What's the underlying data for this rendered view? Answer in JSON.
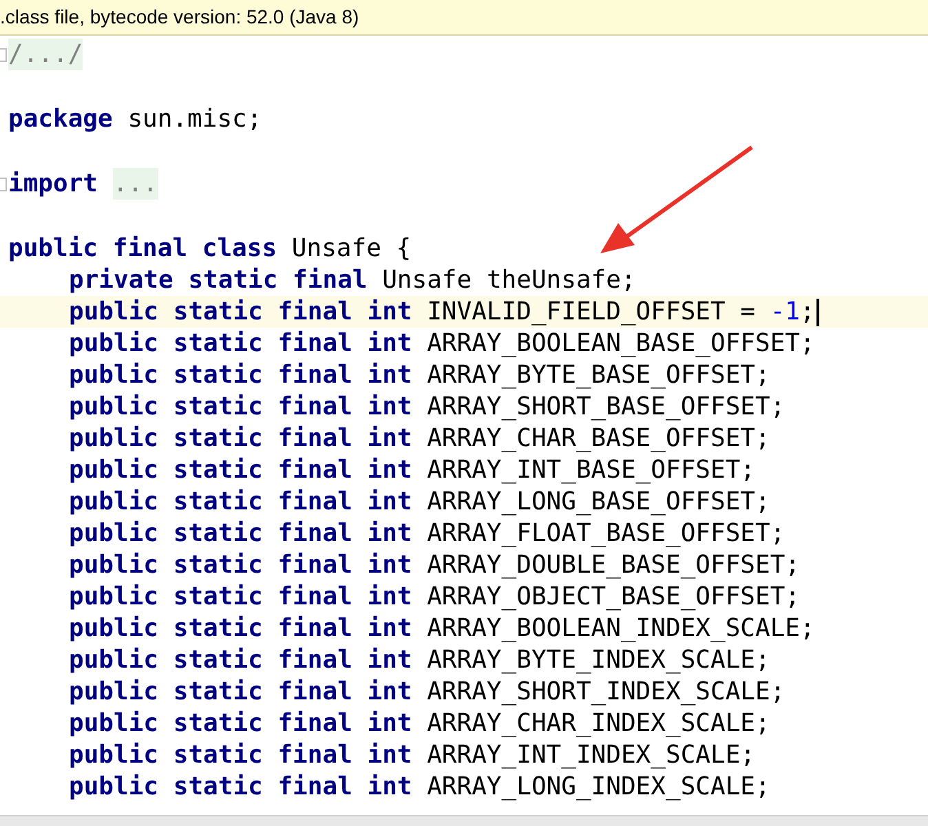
{
  "banner": {
    "text": ".class file, bytecode version: 52.0 (Java 8)"
  },
  "editor": {
    "lines": [
      {
        "kind": "code",
        "foldable": true,
        "current": false,
        "tokens": [
          {
            "kind": "folded",
            "text": "/.../"
          }
        ]
      },
      {
        "kind": "blank"
      },
      {
        "kind": "code",
        "foldable": false,
        "current": false,
        "tokens": [
          {
            "kind": "keyword",
            "text": "package"
          },
          {
            "kind": "text",
            "text": " sun.misc;"
          }
        ]
      },
      {
        "kind": "blank"
      },
      {
        "kind": "code",
        "foldable": true,
        "current": false,
        "tokens": [
          {
            "kind": "keyword",
            "text": "import"
          },
          {
            "kind": "folded",
            "text": "..."
          }
        ]
      },
      {
        "kind": "blank"
      },
      {
        "kind": "code",
        "foldable": false,
        "current": false,
        "tokens": [
          {
            "kind": "keyword",
            "text": "public final class"
          },
          {
            "kind": "text",
            "text": " Unsafe {"
          }
        ],
        "children": [
          {
            "kind": "code",
            "foldable": false,
            "current": false,
            "tokens": [
              {
                "kind": "keyword",
                "text": "private static final"
              },
              {
                "kind": "text",
                "text": " Unsafe theUnsafe;"
              }
            ]
          },
          {
            "kind": "code",
            "foldable": false,
            "current": true,
            "tokens": [
              {
                "kind": "keyword",
                "text": "public static final int"
              },
              {
                "kind": "text",
                "text": " INVALID_FIELD_OFFSET = "
              },
              {
                "kind": "number",
                "text": "-1"
              },
              {
                "kind": "text",
                "text": ";"
              }
            ]
          },
          {
            "kind": "code",
            "foldable": false,
            "current": false,
            "tokens": [
              {
                "kind": "keyword",
                "text": "public static final int"
              },
              {
                "kind": "text",
                "text": " ARRAY_BOOLEAN_BASE_OFFSET;"
              }
            ]
          },
          {
            "kind": "code",
            "foldable": false,
            "current": false,
            "tokens": [
              {
                "kind": "keyword",
                "text": "public static final int"
              },
              {
                "kind": "text",
                "text": " ARRAY_BYTE_BASE_OFFSET;"
              }
            ]
          },
          {
            "kind": "code",
            "foldable": false,
            "current": false,
            "tokens": [
              {
                "kind": "keyword",
                "text": "public static final int"
              },
              {
                "kind": "text",
                "text": " ARRAY_SHORT_BASE_OFFSET;"
              }
            ]
          },
          {
            "kind": "code",
            "foldable": false,
            "current": false,
            "tokens": [
              {
                "kind": "keyword",
                "text": "public static final int"
              },
              {
                "kind": "text",
                "text": " ARRAY_CHAR_BASE_OFFSET;"
              }
            ]
          },
          {
            "kind": "code",
            "foldable": false,
            "current": false,
            "tokens": [
              {
                "kind": "keyword",
                "text": "public static final int"
              },
              {
                "kind": "text",
                "text": " ARRAY_INT_BASE_OFFSET;"
              }
            ]
          },
          {
            "kind": "code",
            "foldable": false,
            "current": false,
            "tokens": [
              {
                "kind": "keyword",
                "text": "public static final int"
              },
              {
                "kind": "text",
                "text": " ARRAY_LONG_BASE_OFFSET;"
              }
            ]
          },
          {
            "kind": "code",
            "foldable": false,
            "current": false,
            "tokens": [
              {
                "kind": "keyword",
                "text": "public static final int"
              },
              {
                "kind": "text",
                "text": " ARRAY_FLOAT_BASE_OFFSET;"
              }
            ]
          },
          {
            "kind": "code",
            "foldable": false,
            "current": false,
            "tokens": [
              {
                "kind": "keyword",
                "text": "public static final int"
              },
              {
                "kind": "text",
                "text": " ARRAY_DOUBLE_BASE_OFFSET;"
              }
            ]
          },
          {
            "kind": "code",
            "foldable": false,
            "current": false,
            "tokens": [
              {
                "kind": "keyword",
                "text": "public static final int"
              },
              {
                "kind": "text",
                "text": " ARRAY_OBJECT_BASE_OFFSET;"
              }
            ]
          },
          {
            "kind": "code",
            "foldable": false,
            "current": false,
            "tokens": [
              {
                "kind": "keyword",
                "text": "public static final int"
              },
              {
                "kind": "text",
                "text": " ARRAY_BOOLEAN_INDEX_SCALE;"
              }
            ]
          },
          {
            "kind": "code",
            "foldable": false,
            "current": false,
            "tokens": [
              {
                "kind": "keyword",
                "text": "public static final int"
              },
              {
                "kind": "text",
                "text": " ARRAY_BYTE_INDEX_SCALE;"
              }
            ]
          },
          {
            "kind": "code",
            "foldable": false,
            "current": false,
            "tokens": [
              {
                "kind": "keyword",
                "text": "public static final int"
              },
              {
                "kind": "text",
                "text": " ARRAY_SHORT_INDEX_SCALE;"
              }
            ]
          },
          {
            "kind": "code",
            "foldable": false,
            "current": false,
            "tokens": [
              {
                "kind": "keyword",
                "text": "public static final int"
              },
              {
                "kind": "text",
                "text": " ARRAY_CHAR_INDEX_SCALE;"
              }
            ]
          },
          {
            "kind": "code",
            "foldable": false,
            "current": false,
            "tokens": [
              {
                "kind": "keyword",
                "text": "public static final int"
              },
              {
                "kind": "text",
                "text": " ARRAY_INT_INDEX_SCALE;"
              }
            ]
          },
          {
            "kind": "code",
            "foldable": false,
            "current": false,
            "tokens": [
              {
                "kind": "keyword",
                "text": "public static final int"
              },
              {
                "kind": "text",
                "text": " ARRAY_LONG_INDEX_SCALE;"
              }
            ]
          }
        ]
      }
    ]
  }
}
